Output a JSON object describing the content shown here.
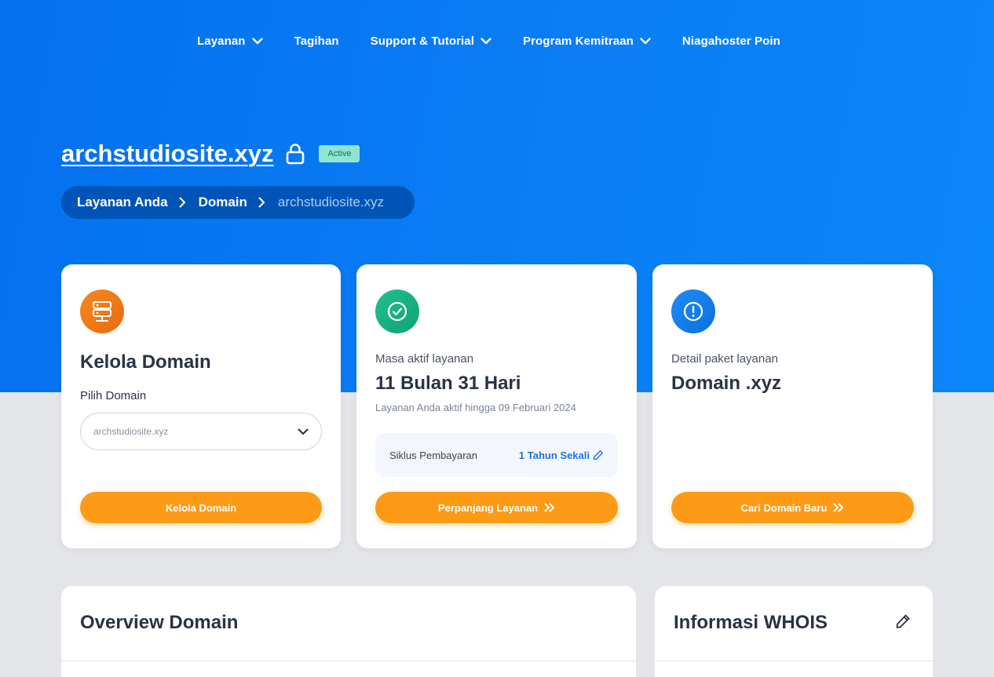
{
  "nav": {
    "items": [
      {
        "label": "Layanan",
        "dropdown": true
      },
      {
        "label": "Tagihan",
        "dropdown": false
      },
      {
        "label": "Support & Tutorial",
        "dropdown": true
      },
      {
        "label": "Program Kemitraan",
        "dropdown": true
      },
      {
        "label": "Niagahoster Poin",
        "dropdown": false
      }
    ]
  },
  "header": {
    "domain": "archstudiosite.xyz",
    "status": "Active",
    "icon": "lock-icon"
  },
  "breadcrumb": {
    "items": [
      "Layanan Anda",
      "Domain",
      "archstudiosite.xyz"
    ]
  },
  "cards": {
    "manage": {
      "icon": "server-icon",
      "title": "Kelola Domain",
      "field_label": "Pilih Domain",
      "select_value": "archstudiosite.xyz",
      "button": "Kelola Domain"
    },
    "active": {
      "icon": "check-circle-icon",
      "label": "Masa aktif layanan",
      "value": "11 Bulan 31 Hari",
      "subtext": "Layanan Anda aktif hingga 09 Februari 2024",
      "cycle_label": "Siklus Pembayaran",
      "cycle_value": "1 Tahun Sekali",
      "button": "Perpanjang Layanan"
    },
    "package": {
      "icon": "alert-circle-icon",
      "label": "Detail paket layanan",
      "value": "Domain .xyz",
      "button": "Cari Domain Baru"
    }
  },
  "panels": {
    "overview": {
      "title": "Overview Domain"
    },
    "whois": {
      "title": "Informasi WHOIS"
    }
  },
  "colors": {
    "hero": "#0a7ef5",
    "accent_button": "#fd9a16",
    "badge": "#8ee6d2",
    "link": "#1a73e8"
  }
}
